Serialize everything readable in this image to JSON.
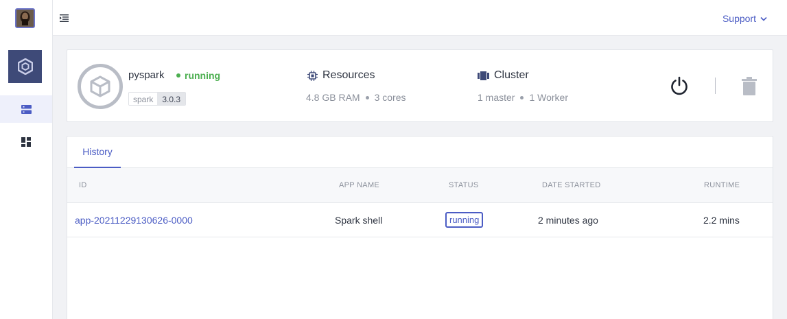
{
  "header": {
    "support_label": "Support",
    "menu_icon": "menu-collapse-icon",
    "chevron_icon": "chevron-down-icon"
  },
  "sidebar": {
    "items": [
      {
        "icon": "servers-icon",
        "active": true
      },
      {
        "icon": "dashboard-icon",
        "active": false
      }
    ]
  },
  "cluster": {
    "name": "pyspark",
    "status": "running",
    "version_key": "spark",
    "version_value": "3.0.3",
    "resources_title": "Resources",
    "ram": "4.8 GB RAM",
    "cores": "3 cores",
    "cluster_title": "Cluster",
    "master": "1 master",
    "workers": "1 Worker"
  },
  "history": {
    "tab_label": "History",
    "columns": [
      "ID",
      "APP NAME",
      "STATUS",
      "DATE STARTED",
      "RUNTIME"
    ],
    "rows": [
      {
        "id": "app-20211229130626-0000",
        "app_name": "Spark shell",
        "status": "running",
        "date_started": "2 minutes ago",
        "runtime": "2.2 mins"
      }
    ]
  },
  "colors": {
    "accent": "#4b5cc4",
    "running_green": "#4caf50",
    "sidebar_tile": "#3e4a78"
  }
}
